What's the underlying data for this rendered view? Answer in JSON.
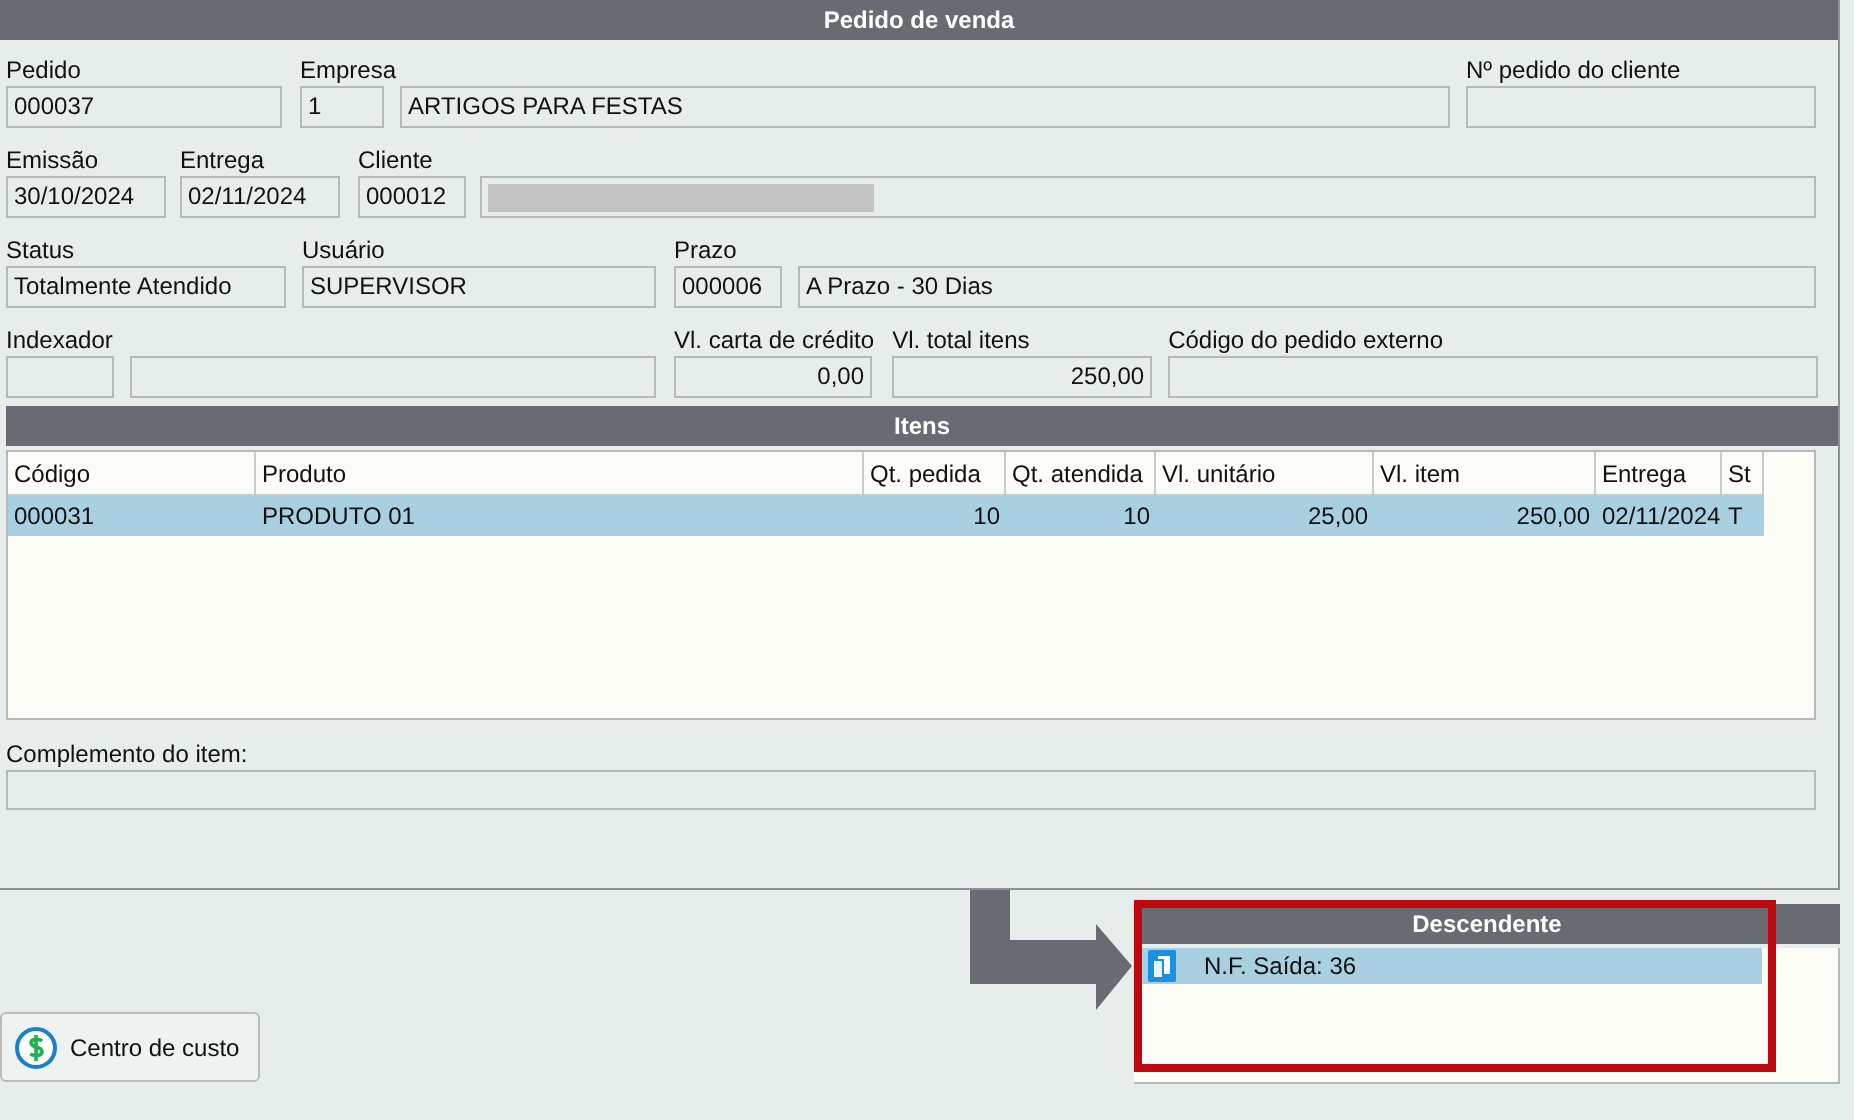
{
  "window": {
    "title": "Pedido de venda"
  },
  "form_rows": [
    [
      {
        "label": "Pedido",
        "boxes": [
          {
            "kind": "text",
            "value": "000037"
          }
        ]
      },
      {
        "label": "Empresa",
        "boxes": [
          {
            "kind": "text",
            "value": "1"
          },
          {
            "kind": "text",
            "value": "ARTIGOS PARA FESTAS"
          }
        ]
      },
      {
        "label": "Nº pedido do cliente",
        "boxes": [
          {
            "kind": "text"
          }
        ]
      }
    ],
    [
      {
        "label": "Emissão",
        "boxes": [
          {
            "kind": "text",
            "value": "30/10/2024"
          }
        ]
      },
      {
        "label": "Entrega",
        "boxes": [
          {
            "kind": "text",
            "value": "02/11/2024"
          }
        ]
      },
      {
        "label": "Cliente",
        "boxes": [
          {
            "kind": "text",
            "value": "000012"
          },
          {
            "kind": "redacted"
          }
        ]
      }
    ],
    [
      {
        "label": "Status",
        "boxes": [
          {
            "kind": "text",
            "value": "Totalmente Atendido"
          }
        ]
      },
      {
        "label": "Usuário",
        "boxes": [
          {
            "kind": "text",
            "value": "SUPERVISOR"
          }
        ]
      },
      {
        "label": "Prazo",
        "boxes": [
          {
            "kind": "text",
            "value": "000006"
          },
          {
            "kind": "text",
            "value": "A Prazo - 30 Dias"
          }
        ]
      }
    ],
    [
      {
        "label": "Indexador",
        "boxes": [
          {
            "kind": "text"
          },
          {
            "kind": "text"
          }
        ]
      },
      {
        "label": "Vl. carta de crédito",
        "boxes": [
          {
            "value": "0,00",
            "kind": "number"
          }
        ]
      },
      {
        "label": "Vl. total itens",
        "boxes": [
          {
            "value": "250,00",
            "kind": "number"
          }
        ]
      },
      {
        "label": "Código do pedido externo",
        "boxes": [
          {
            "kind": "text"
          }
        ]
      }
    ]
  ],
  "items": {
    "title": "Itens",
    "columns": [
      {
        "label": "Código"
      },
      {
        "label": "Produto"
      },
      {
        "label": "Qt. pedida",
        "kind": "number"
      },
      {
        "label": "Qt. atendida",
        "kind": "number"
      },
      {
        "label": "Vl. unitário",
        "kind": "number"
      },
      {
        "label": "Vl. item",
        "kind": "number"
      },
      {
        "label": "Entrega"
      },
      {
        "label": "St"
      }
    ],
    "rows": [
      {
        "selected": true,
        "cells": [
          "000031",
          "PRODUTO 01",
          "10",
          "10",
          "25,00",
          "250,00",
          "02/11/2024",
          "T"
        ]
      }
    ]
  },
  "complement": {
    "label": "Complemento do item:"
  },
  "cost_center_button": {
    "label": "Centro de custo"
  },
  "descendants": {
    "title": "Descendente",
    "highlighted": true,
    "items": [
      {
        "label": "N.F. Saída: 36",
        "selected": true
      }
    ]
  }
}
